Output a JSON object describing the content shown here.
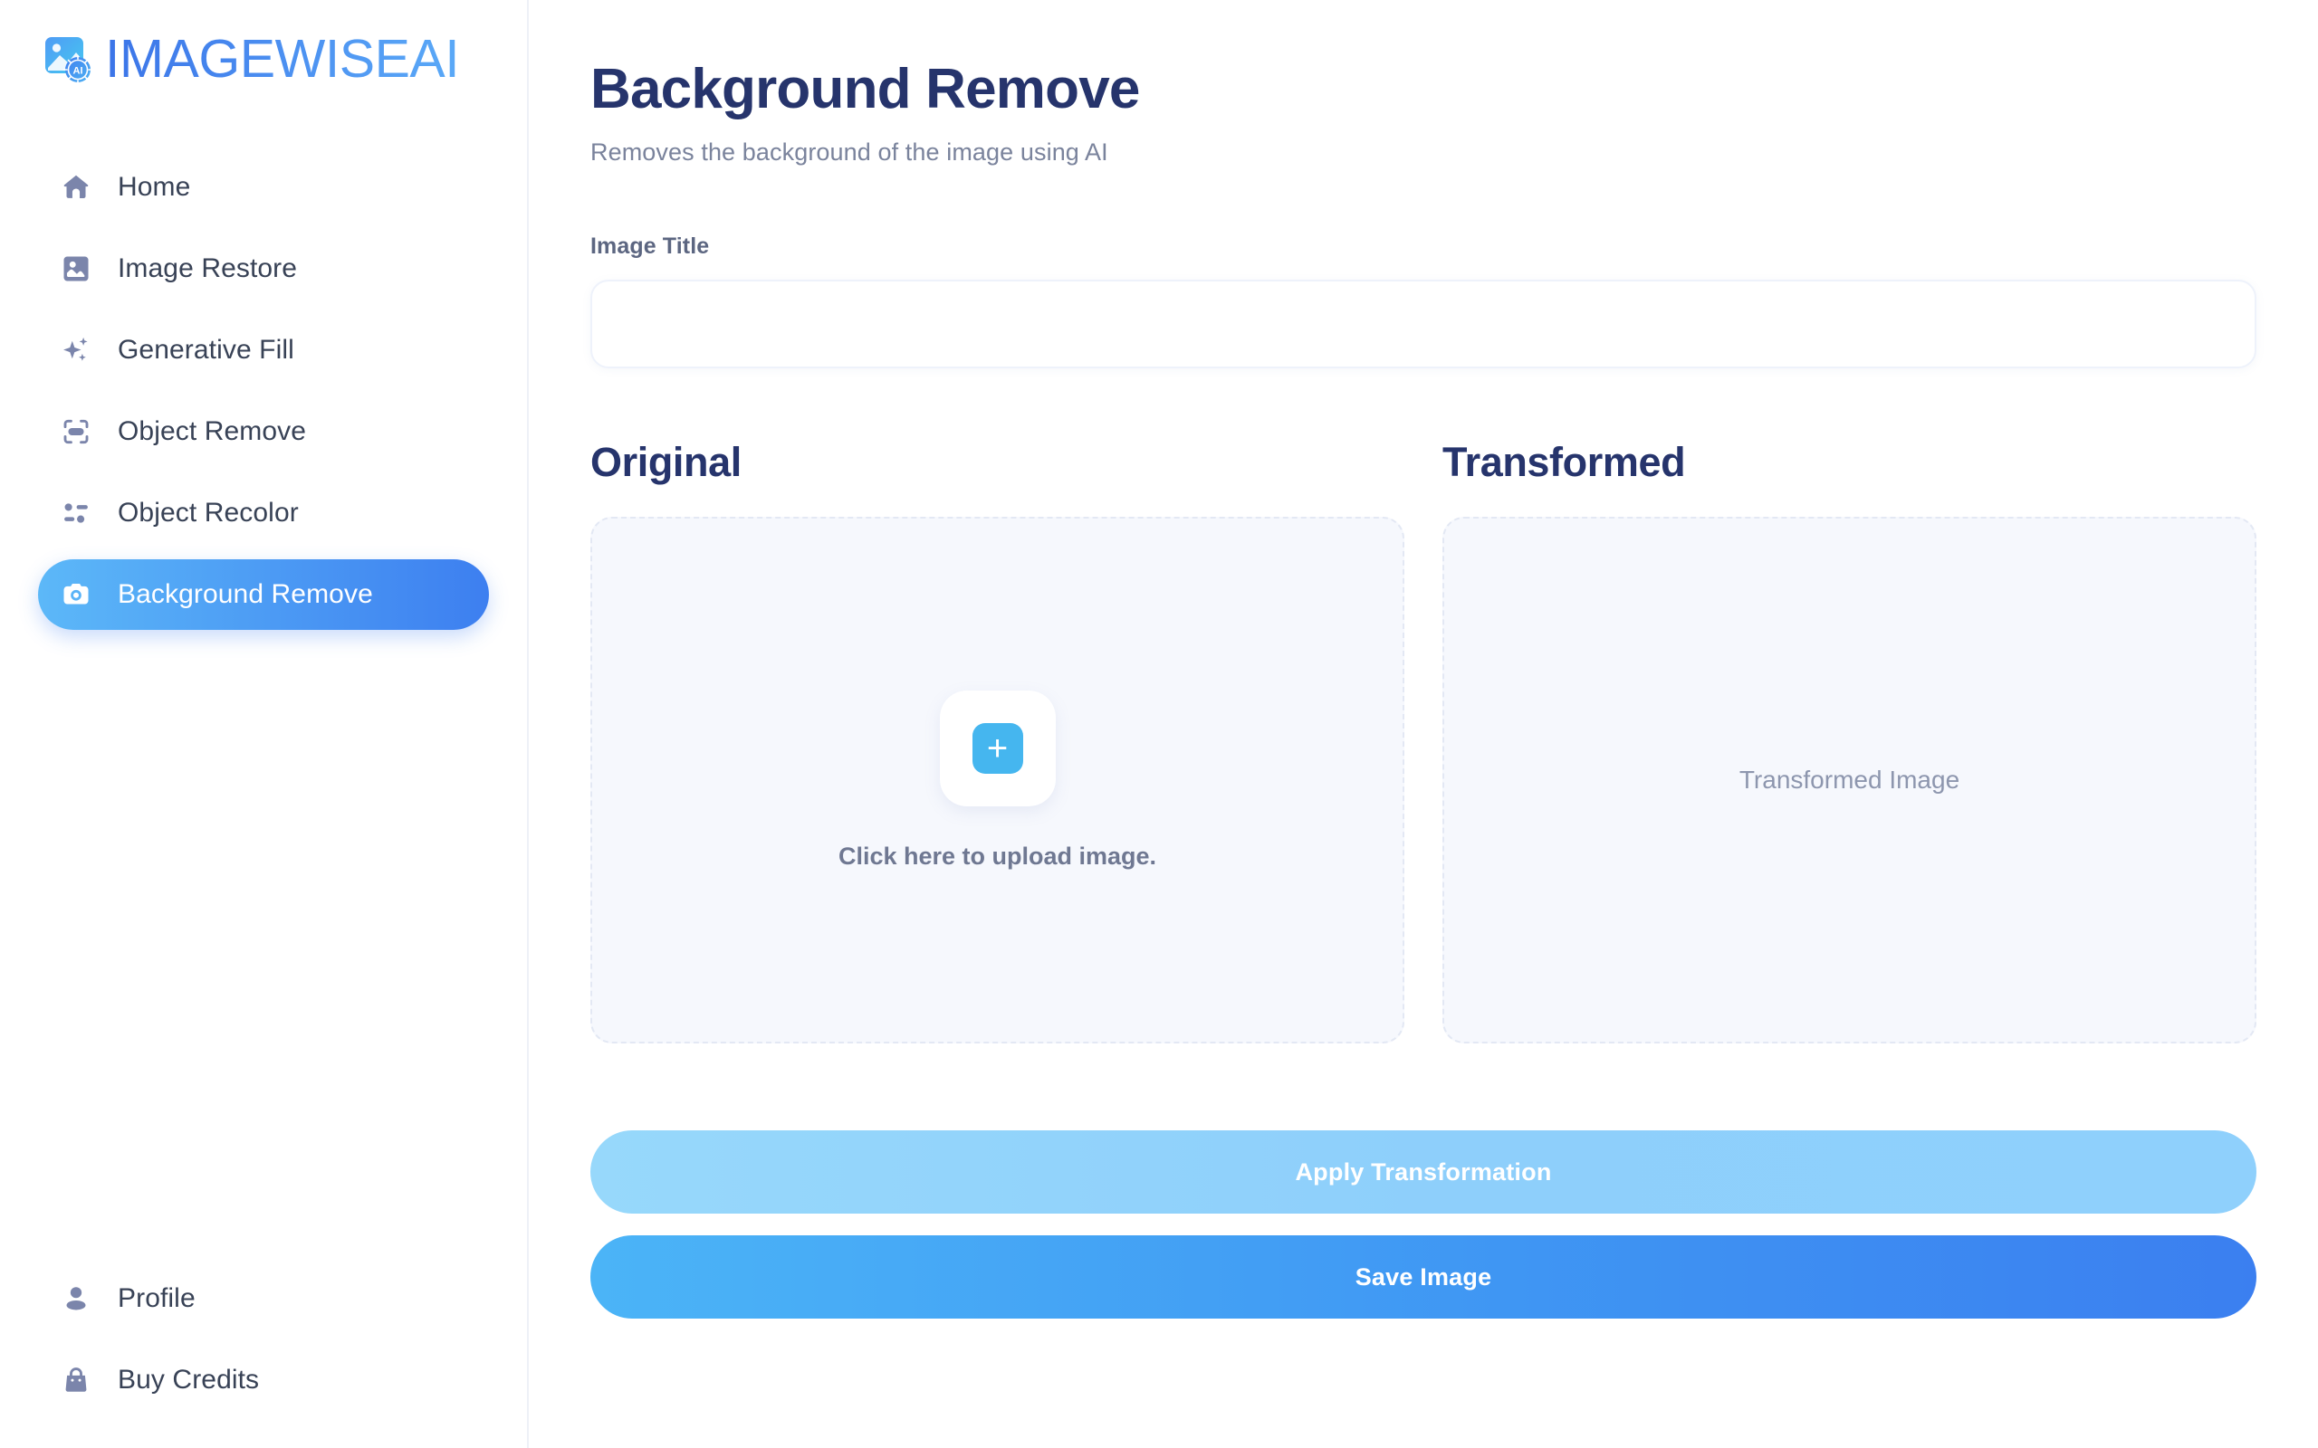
{
  "brand": {
    "name": "IMAGEWISEAI",
    "logo_icon": "image-ai-logo-icon"
  },
  "sidebar": {
    "main_items": [
      {
        "label": "Home",
        "icon": "home-icon",
        "active": false
      },
      {
        "label": "Image Restore",
        "icon": "image-restore-icon",
        "active": false
      },
      {
        "label": "Generative Fill",
        "icon": "sparkles-icon",
        "active": false
      },
      {
        "label": "Object Remove",
        "icon": "scan-object-icon",
        "active": false
      },
      {
        "label": "Object Recolor",
        "icon": "sliders-icon",
        "active": false
      },
      {
        "label": "Background Remove",
        "icon": "camera-icon",
        "active": true
      }
    ],
    "bottom_items": [
      {
        "label": "Profile",
        "icon": "user-icon"
      },
      {
        "label": "Buy Credits",
        "icon": "bag-icon"
      }
    ]
  },
  "main": {
    "title": "Background Remove",
    "subtitle": "Removes the background of the image using AI",
    "form": {
      "image_title_label": "Image Title",
      "image_title_value": "",
      "image_title_placeholder": ""
    },
    "panels": {
      "original": {
        "heading": "Original",
        "upload_text": "Click here to upload image.",
        "plus_icon": "plus-icon"
      },
      "transformed": {
        "heading": "Transformed",
        "placeholder_text": "Transformed Image"
      }
    },
    "actions": {
      "apply_label": "Apply Transformation",
      "save_label": "Save Image"
    }
  },
  "colors": {
    "accent_blue": "#3b7ff0",
    "accent_light_blue": "#5cb8f8",
    "title_navy": "#26346c",
    "muted_text": "#7a839c",
    "icon_slate": "#7b85ab",
    "panel_bg": "#f6f8fd"
  }
}
